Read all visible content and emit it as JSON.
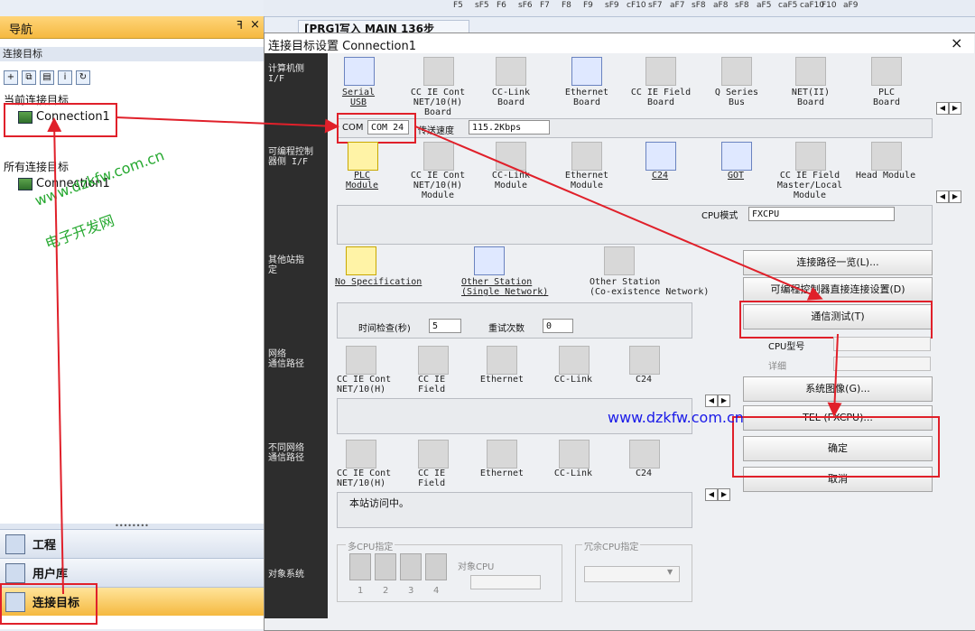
{
  "nav": {
    "title": "导航",
    "pin": "ꟻ",
    "close": "×",
    "section": "连接目标",
    "current_group": "当前连接目标",
    "current_item": "Connection1",
    "all_group": "所有连接目标",
    "all_item": "Connection1",
    "bottom": [
      {
        "label": "工程"
      },
      {
        "label": "用户库"
      },
      {
        "label": "连接目标"
      }
    ]
  },
  "topbar": {
    "fkeys": [
      "F5",
      "sF5",
      "F6",
      "sF6",
      "F7",
      "F8",
      "F9",
      "sF9",
      "cF10",
      "sF7",
      "aF7",
      "sF8",
      "aF8",
      "sF8",
      "aF5",
      "caF5",
      "caF10",
      "F10",
      "aF9"
    ]
  },
  "tab": {
    "label": "[PRG]写入 MAIN 136步"
  },
  "dialog": {
    "title": "连接目标设置 Connection1",
    "close": "×",
    "pc_if": {
      "label": "计算机侧\nI/F",
      "items": [
        {
          "label": "Serial\nUSB",
          "selected": true
        },
        {
          "label": "CC IE Cont\nNET/10(H)\nBoard"
        },
        {
          "label": "CC-Link\nBoard"
        },
        {
          "label": "Ethernet\nBoard"
        },
        {
          "label": "CC IE Field\nBoard"
        },
        {
          "label": "Q Series\nBus"
        },
        {
          "label": "NET(II)\nBoard"
        },
        {
          "label": "PLC\nBoard"
        }
      ],
      "com_label": "COM",
      "com_value": "COM 24",
      "speed_label": "传送速度",
      "speed_value": "115.2Kbps"
    },
    "plc_if": {
      "label": "可编程控制\n器侧 I/F",
      "items": [
        {
          "label": "PLC\nModule",
          "selected": true
        },
        {
          "label": "CC IE Cont\nNET/10(H)\nModule"
        },
        {
          "label": "CC-Link\nModule"
        },
        {
          "label": "Ethernet\nModule"
        },
        {
          "label": "C24"
        },
        {
          "label": "GOT"
        },
        {
          "label": "CC IE Field\nMaster/Local\nModule"
        },
        {
          "label": "Head Module"
        }
      ],
      "cpu_mode_label": "CPU模式",
      "cpu_mode_value": "FXCPU"
    },
    "other_station": {
      "label": "其他站指\n定",
      "items": [
        {
          "label": "No Specification"
        },
        {
          "label": "Other Station\n(Single Network)"
        },
        {
          "label": "Other Station\n(Co-existence Network)"
        }
      ],
      "timeout_label": "时间检查(秒)",
      "timeout_value": "5",
      "retry_label": "重试次数",
      "retry_value": "0"
    },
    "network_route": {
      "label": "网络\n通信路径",
      "items": [
        "CC IE Cont\nNET/10(H)",
        "CC IE\nField",
        "Ethernet",
        "CC-Link",
        "C24"
      ]
    },
    "diff_network": {
      "label": "不同网络\n通信路径",
      "items": [
        "CC IE Cont\nNET/10(H)",
        "CC IE\nField",
        "Ethernet",
        "CC-Link",
        "C24"
      ],
      "status": "本站访问中。"
    },
    "target_system": {
      "label": "对象系统",
      "multi_cpu_label": "多CPU指定",
      "multi_cpu_nums": [
        "1",
        "2",
        "3",
        "4"
      ],
      "target_cpu_label": "对象CPU",
      "redundant_label": "冗余CPU指定"
    },
    "buttons": {
      "route_list": "连接路径一览(L)...",
      "plc_direct": "可编程控制器直接连接设置(D)",
      "comm_test": "通信测试(T)",
      "cpu_type_label": "CPU型号",
      "detail_label": "详细",
      "system_image": "系统图像(G)...",
      "tel": "TEL (FXCPU)...",
      "ok": "确定",
      "cancel": "取消"
    }
  },
  "watermarks": {
    "left_url": "www.dzkfw.com.cn",
    "left_cn": "电子开发网",
    "center_url": "www.dzkfw.com.cn"
  },
  "colors": {
    "highlight": "#e0202a",
    "nav_header": "#f5b940"
  }
}
